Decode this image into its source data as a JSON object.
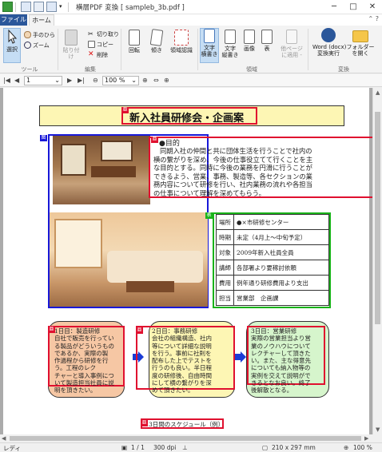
{
  "window": {
    "title": "横層PDF 変換 [ sampleb_3b.pdf ]",
    "minimize": "─",
    "maximize": "□",
    "close": "✕"
  },
  "tabs": {
    "file": "ファイル",
    "home": "ホーム",
    "right": "⌃ ?"
  },
  "ribbon": {
    "select": "選択",
    "hand": "手のひら",
    "zoom": "ズーム",
    "tool_group": "ツール",
    "paste": "貼り付け",
    "cut": "切り取り",
    "copy": "コピー",
    "delete": "削除",
    "edit_group": "編集",
    "rotate": "回転",
    "tilt": "傾き",
    "area_recognition": "領域認識",
    "text_horizontal": "文字\n横書き",
    "text_vertical": "文字\n縦書き",
    "image": "画像",
    "table": "表",
    "other_pages": "他ページ\nに適用 -",
    "area_group": "領域",
    "word_convert": "Word (docx)\n変換実行",
    "open_folder": "フォルダー\nを開く",
    "convert_group": "変換"
  },
  "nav": {
    "page_value": "1",
    "zoom_value": "100 %"
  },
  "document": {
    "heading": "新入社員研修会・企画案",
    "purpose_label": "●目的",
    "purpose_lines": [
      "同期入社の仲間と共に団体生活を行うことで社内の",
      "横の繋がりを深め、今後の仕事役立てて行くことを主",
      "な目的とする。同時に今後の業務を円滑に行うことが",
      "できるよう、営業、事務、製造等、各セクションの業",
      "務内容について研修を行い、社内業務の流れや各担当",
      "の仕事について理解を深めてもらう。"
    ],
    "info_table": [
      {
        "label": "場所",
        "value": "●×市研修センター"
      },
      {
        "label": "時期",
        "value": "未定（4月上〜中旬予定）"
      },
      {
        "label": "対象",
        "value": "2009年新入社員全員"
      },
      {
        "label": "講師",
        "value": "各部署より要稼討依頼"
      },
      {
        "label": "費用",
        "value": "例年通り研修費用より支出"
      },
      {
        "label": "担当",
        "value": "営業部　企画課"
      }
    ],
    "days": [
      {
        "title": "1日目：製造研修",
        "lines": [
          "自社で販売を行ってい",
          "る製品がどういうもの",
          "であるか、実際の製",
          "作過程から研修を行",
          "う。工程のレク",
          "チャーと導入事例につ",
          "いて製造担当社員に説",
          "明を頂きたい。"
        ]
      },
      {
        "title": "2日目：事務研修",
        "lines": [
          "会社の組織構造、社内",
          "等について詳細な説明",
          "を行う。事前に社則を",
          "配布した上でテストを",
          "行うのも良い。半日程",
          "度の研修後、自由時間",
          "にして横の繋がりを深",
          "めて頂きたい。"
        ]
      },
      {
        "title": "3日目：営業研修",
        "lines": [
          "実際の営業担当より営",
          "業のノウハウについて",
          "レクチャーして頂きた",
          "い。また、主な得意先",
          "についても納入物等の",
          "実例を交えて説明がで",
          "きるとなお良い。終了",
          "後解散となる。"
        ]
      }
    ],
    "caption": "3日間のスケジュール（例）"
  },
  "status": {
    "ready": "レディ",
    "page": "1 / 1",
    "dpi": "300 dpi",
    "paper": "210 x 297 mm",
    "zoom": "100 %"
  },
  "colors": {
    "red": "#e0102f",
    "blue": "#1818d8",
    "green": "#19b319",
    "heading_fill": "#fdf6b4",
    "box1": "#f6c7a4",
    "box2": "#fdf6b4",
    "box3": "#d6f5cc",
    "arrow": "#1a3cd6",
    "accent": "#2b579a"
  }
}
